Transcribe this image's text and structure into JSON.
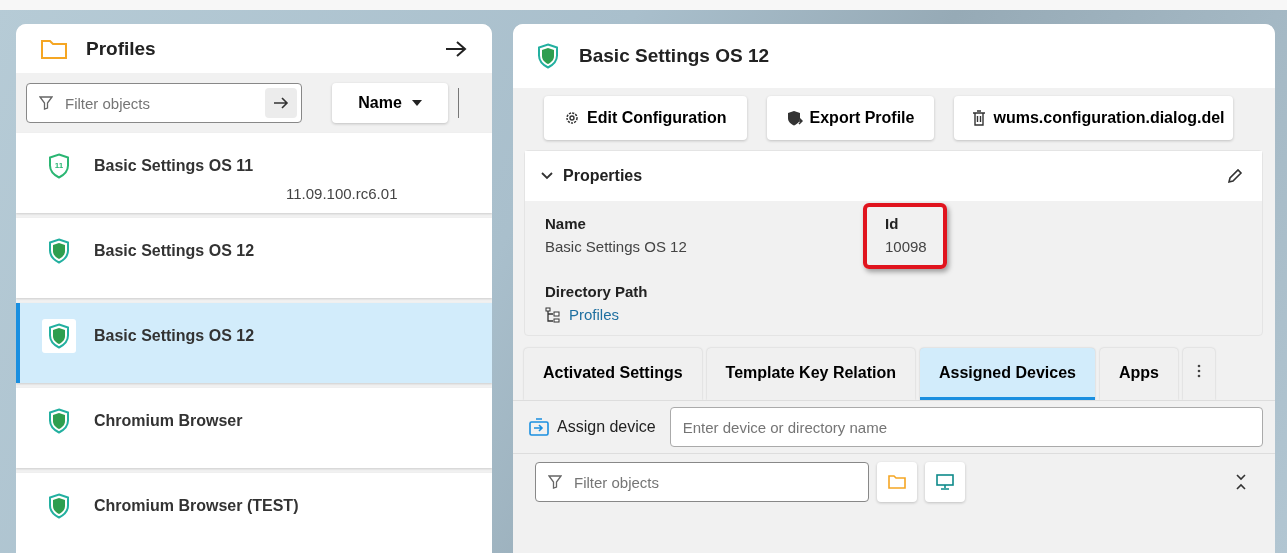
{
  "profiles_panel": {
    "title": "Profiles",
    "filter": {
      "placeholder": "Filter objects"
    },
    "sort": {
      "label": "Name"
    },
    "items": [
      {
        "name": "Basic Settings OS 11",
        "kind": "numbered",
        "badge": "11",
        "version": "11.09.100.rc6.01",
        "selected": false
      },
      {
        "name": "Basic Settings OS 12",
        "kind": "shield",
        "selected": false
      },
      {
        "name": "Basic Settings OS 12",
        "kind": "shield",
        "selected": true
      },
      {
        "name": "Chromium Browser",
        "kind": "shield",
        "selected": false
      },
      {
        "name": "Chromium Browser (TEST)",
        "kind": "shield",
        "selected": false
      }
    ]
  },
  "detail": {
    "title": "Basic Settings OS 12",
    "actions": [
      {
        "label": "Edit Configuration",
        "kind": "gear"
      },
      {
        "label": "Export Profile",
        "kind": "export"
      },
      {
        "label": "wums.configuration.dialog.del",
        "kind": "trash"
      }
    ],
    "properties": {
      "title": "Properties",
      "expanded": true,
      "fields": [
        {
          "label": "Name",
          "value": "Basic Settings OS 12",
          "kind": "text",
          "highlighted": false
        },
        {
          "label": "Id",
          "value": "10098",
          "kind": "text",
          "highlighted": true
        },
        {
          "label": "Directory Path",
          "value": "Profiles",
          "kind": "link",
          "highlighted": false
        }
      ]
    },
    "tabs": [
      {
        "label": "Activated Settings",
        "selected": false
      },
      {
        "label": "Template Key Relation",
        "selected": false
      },
      {
        "label": "Assigned Devices",
        "selected": true
      },
      {
        "label": "Apps",
        "selected": false
      }
    ],
    "assign": {
      "label": "Assign device",
      "placeholder": "Enter device or directory name"
    },
    "filter": {
      "placeholder": "Filter objects"
    }
  }
}
